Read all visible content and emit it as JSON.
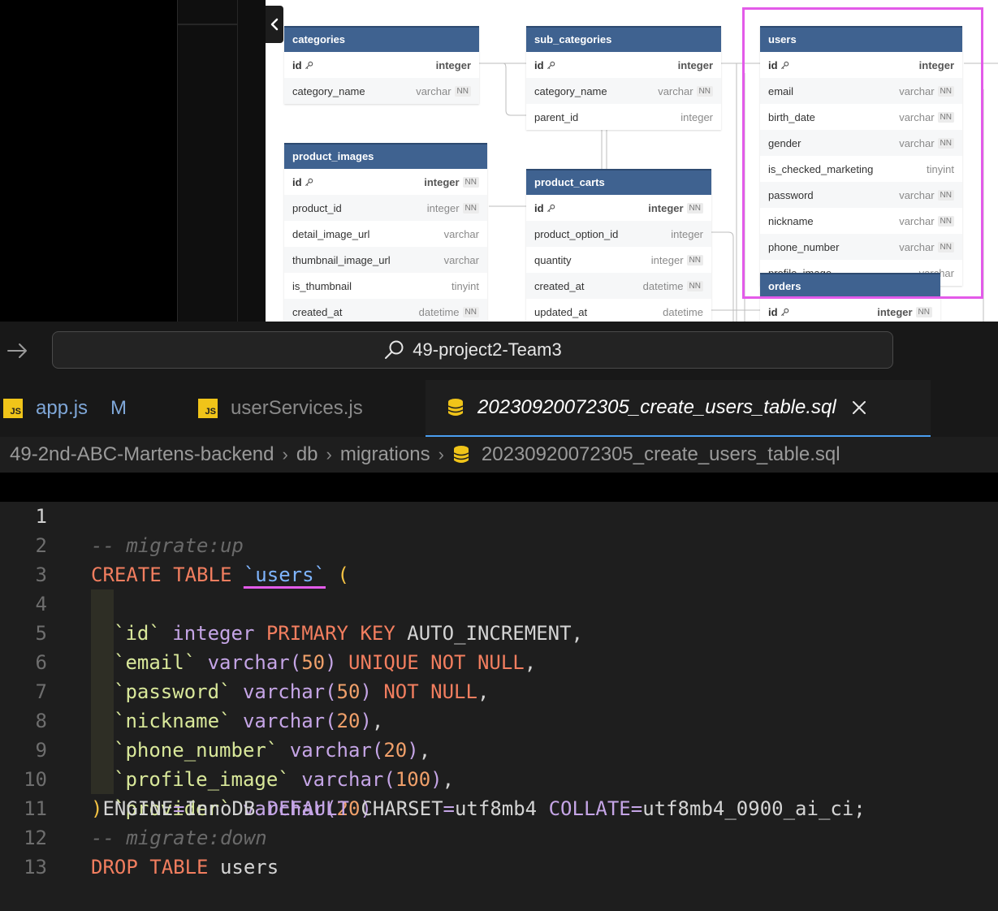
{
  "erd": {
    "tables": [
      {
        "name": "categories",
        "rows": [
          {
            "field": "id",
            "type": "integer",
            "pk": true,
            "nn": false
          },
          {
            "field": "category_name",
            "type": "varchar",
            "pk": false,
            "nn": true
          }
        ]
      },
      {
        "name": "sub_categories",
        "rows": [
          {
            "field": "id",
            "type": "integer",
            "pk": true,
            "nn": false
          },
          {
            "field": "category_name",
            "type": "varchar",
            "pk": false,
            "nn": true
          },
          {
            "field": "parent_id",
            "type": "integer",
            "pk": false,
            "nn": false
          }
        ]
      },
      {
        "name": "users",
        "rows": [
          {
            "field": "id",
            "type": "integer",
            "pk": true,
            "nn": false
          },
          {
            "field": "email",
            "type": "varchar",
            "pk": false,
            "nn": true
          },
          {
            "field": "birth_date",
            "type": "varchar",
            "pk": false,
            "nn": true
          },
          {
            "field": "gender",
            "type": "varchar",
            "pk": false,
            "nn": true
          },
          {
            "field": "is_checked_marketing",
            "type": "tinyint",
            "pk": false,
            "nn": false
          },
          {
            "field": "password",
            "type": "varchar",
            "pk": false,
            "nn": true
          },
          {
            "field": "nickname",
            "type": "varchar",
            "pk": false,
            "nn": true
          },
          {
            "field": "phone_number",
            "type": "varchar",
            "pk": false,
            "nn": true
          },
          {
            "field": "profile_image",
            "type": "varchar",
            "pk": false,
            "nn": false
          }
        ]
      },
      {
        "name": "product_images",
        "rows": [
          {
            "field": "id",
            "type": "integer",
            "pk": true,
            "nn": true
          },
          {
            "field": "product_id",
            "type": "integer",
            "pk": false,
            "nn": true
          },
          {
            "field": "detail_image_url",
            "type": "varchar",
            "pk": false,
            "nn": false
          },
          {
            "field": "thumbnail_image_url",
            "type": "varchar",
            "pk": false,
            "nn": false
          },
          {
            "field": "is_thumbnail",
            "type": "tinyint",
            "pk": false,
            "nn": false
          },
          {
            "field": "created_at",
            "type": "datetime",
            "pk": false,
            "nn": true
          }
        ]
      },
      {
        "name": "product_carts",
        "rows": [
          {
            "field": "id",
            "type": "integer",
            "pk": true,
            "nn": true
          },
          {
            "field": "product_option_id",
            "type": "integer",
            "pk": false,
            "nn": false
          },
          {
            "field": "quantity",
            "type": "integer",
            "pk": false,
            "nn": true
          },
          {
            "field": "created_at",
            "type": "datetime",
            "pk": false,
            "nn": true
          },
          {
            "field": "updated_at",
            "type": "datetime",
            "pk": false,
            "nn": false
          }
        ]
      },
      {
        "name": "orders",
        "rows": [
          {
            "field": "id",
            "type": "integer",
            "pk": true,
            "nn": true
          }
        ]
      }
    ],
    "nn_label": "NN"
  },
  "search": {
    "text": "49-project2-Team3"
  },
  "tabs": [
    {
      "icon": "JS",
      "label": "app.js",
      "badge": "M"
    },
    {
      "icon": "JS",
      "label": "userServices.js"
    },
    {
      "label": "20230920072305_create_users_table.sql"
    }
  ],
  "breadcrumb": [
    "49-2nd-ABC-Martens-backend",
    "db",
    "migrations",
    "20230920072305_create_users_table.sql"
  ],
  "code": {
    "line_numbers": [
      "1",
      "2",
      "3",
      "4",
      "5",
      "6",
      "7",
      "8",
      "9",
      "10",
      "11",
      "12",
      "13"
    ],
    "l1": "-- migrate:up",
    "l2": {
      "kw": "CREATE TABLE",
      "t": "`users`",
      "p": "("
    },
    "l3": {
      "id": "`id`",
      "type": "integer",
      "kw": "PRIMARY KEY",
      "rest": "AUTO_INCREMENT,"
    },
    "l4": {
      "id": "`email`",
      "fn": "varchar(",
      "num": "50",
      "close": ")",
      "kw": "UNIQUE NOT NULL",
      "end": ","
    },
    "l5": {
      "id": "`password`",
      "fn": "varchar(",
      "num": "50",
      "close": ")",
      "kw": "NOT NULL",
      "end": ","
    },
    "l6": {
      "id": "`nickname`",
      "fn": "varchar(",
      "num": "20",
      "close": ")",
      "end": ","
    },
    "l7": {
      "id": "`phone_number`",
      "fn": "varchar(",
      "num": "20",
      "close": ")",
      "end": ","
    },
    "l8": {
      "id": "`profile_image`",
      "fn": "varchar(",
      "num": "100",
      "close": ")",
      "end": ","
    },
    "l9": {
      "id": "`provider`",
      "fn": "varchar(",
      "num": "20",
      "close": ")"
    },
    "l10": {
      "p": ")",
      "a": "ENGINE",
      "eq": "=",
      "b": "InnoDB",
      "kw": "DEFAULT",
      "c": "CHARSET",
      "d": "utf8mb4",
      "f": "COLLATE",
      "g": "utf8mb4_0900_ai_ci;"
    },
    "l11": "-- migrate:down",
    "l12": {
      "kw": "DROP TABLE",
      "t": "users"
    }
  }
}
